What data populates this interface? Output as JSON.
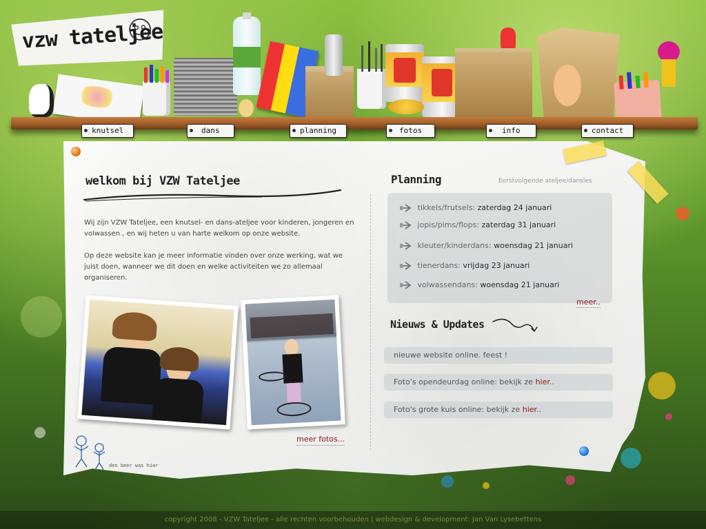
{
  "logo": {
    "text": "vzw tateljee"
  },
  "nav": [
    {
      "label": "knutsel"
    },
    {
      "label": "dans"
    },
    {
      "label": "planning"
    },
    {
      "label": "fotos"
    },
    {
      "label": "info"
    },
    {
      "label": "contact"
    }
  ],
  "welcome": {
    "title": "welkom bij VZW Tateljee",
    "paragraph1": "Wij zijn VZW Tateljee, een knutsel- en dans-ateljee voor kinderen, jongeren en volwassen , en wij heten u van harte welkom op onze website.",
    "paragraph2": "Op deze website kan je meer informatie vinden over onze werking, wat we juist doen, wanneer we dit doen en welke activiteiten we zo allemaal organiseren.",
    "more_photos": "meer fotos...",
    "signature": "den beer was hier"
  },
  "planning": {
    "title": "Planning",
    "subtitle": "Eerstvolgende ateljee/dansles",
    "items": [
      {
        "label": "tikkels/frutsels:",
        "date": "zaterdag 24 januari"
      },
      {
        "label": "jopis/pims/flops:",
        "date": "zaterdag 31 januari"
      },
      {
        "label": "kleuter/kinderdans:",
        "date": "woensdag 21 januari"
      },
      {
        "label": "tienerdans:",
        "date": "vrijdag 23 januari"
      },
      {
        "label": "volwassendans:",
        "date": "woensdag 21 januari"
      }
    ],
    "more": "meer.."
  },
  "news": {
    "title": "Nieuws & Updates",
    "items": [
      {
        "text": "nieuwe website online. feest !",
        "link": ""
      },
      {
        "text": "Foto's opendeurdag online: bekijk ze ",
        "link": "hier",
        "tail": ".."
      },
      {
        "text": "Foto's grote kuis online: bekijk ze ",
        "link": "hier",
        "tail": ".."
      }
    ]
  },
  "footer": {
    "text": "copyright 2008 - VZW Tateljee -  alle rechten voorbehouden | webdesign & development: Jan Van Lysebettens"
  },
  "colors": {
    "accent_red": "#8a1414",
    "bg_green": "#5f9a2c",
    "shelf_wood": "#9c5b26",
    "tape_yellow": "#fadc5a"
  },
  "icons": [
    "arrow-right-icon",
    "smiley-face-icon",
    "orange-pin-icon",
    "blue-pin-icon"
  ]
}
